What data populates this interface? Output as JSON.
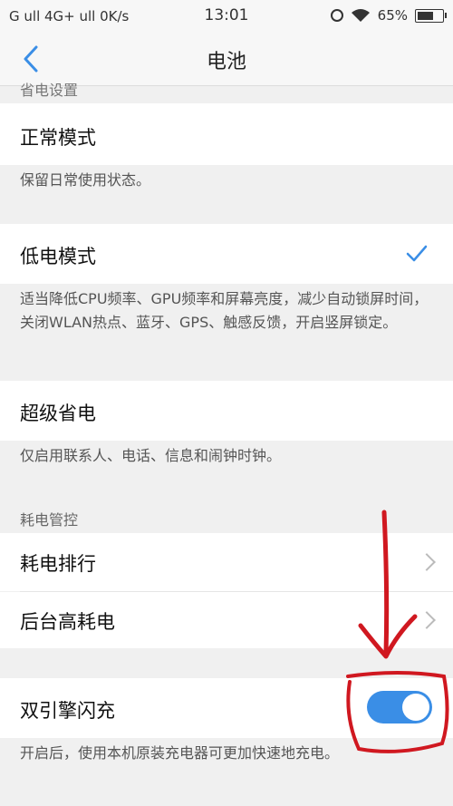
{
  "statusbar": {
    "left": "G ull 4G+ ull  0K/s",
    "time": "13:01",
    "battery": "65%",
    "battery_level": 0.65
  },
  "header": {
    "title": "电池"
  },
  "sections": {
    "power_saving": "省电设置",
    "power_control": "耗电管控"
  },
  "modes": [
    {
      "title": "正常模式",
      "desc": "保留日常使用状态。",
      "selected": false
    },
    {
      "title": "低电模式",
      "desc": "适当降低CPU频率、GPU频率和屏幕亮度，减少自动锁屏时间，关闭WLAN热点、蓝牙、GPS、触感反馈，开启竖屏锁定。",
      "selected": true
    },
    {
      "title": "超级省电",
      "desc": "仅启用联系人、电话、信息和闹钟时钟。",
      "selected": false
    }
  ],
  "control_items": [
    {
      "title": "耗电排行"
    },
    {
      "title": "后台高耗电"
    }
  ],
  "dual_engine": {
    "title": "双引擎闪充",
    "desc": "开启后，使用本机原装充电器可更加快速地充电。",
    "enabled": true
  },
  "colors": {
    "accent": "#3a8ee6",
    "annotation": "#d01820"
  }
}
